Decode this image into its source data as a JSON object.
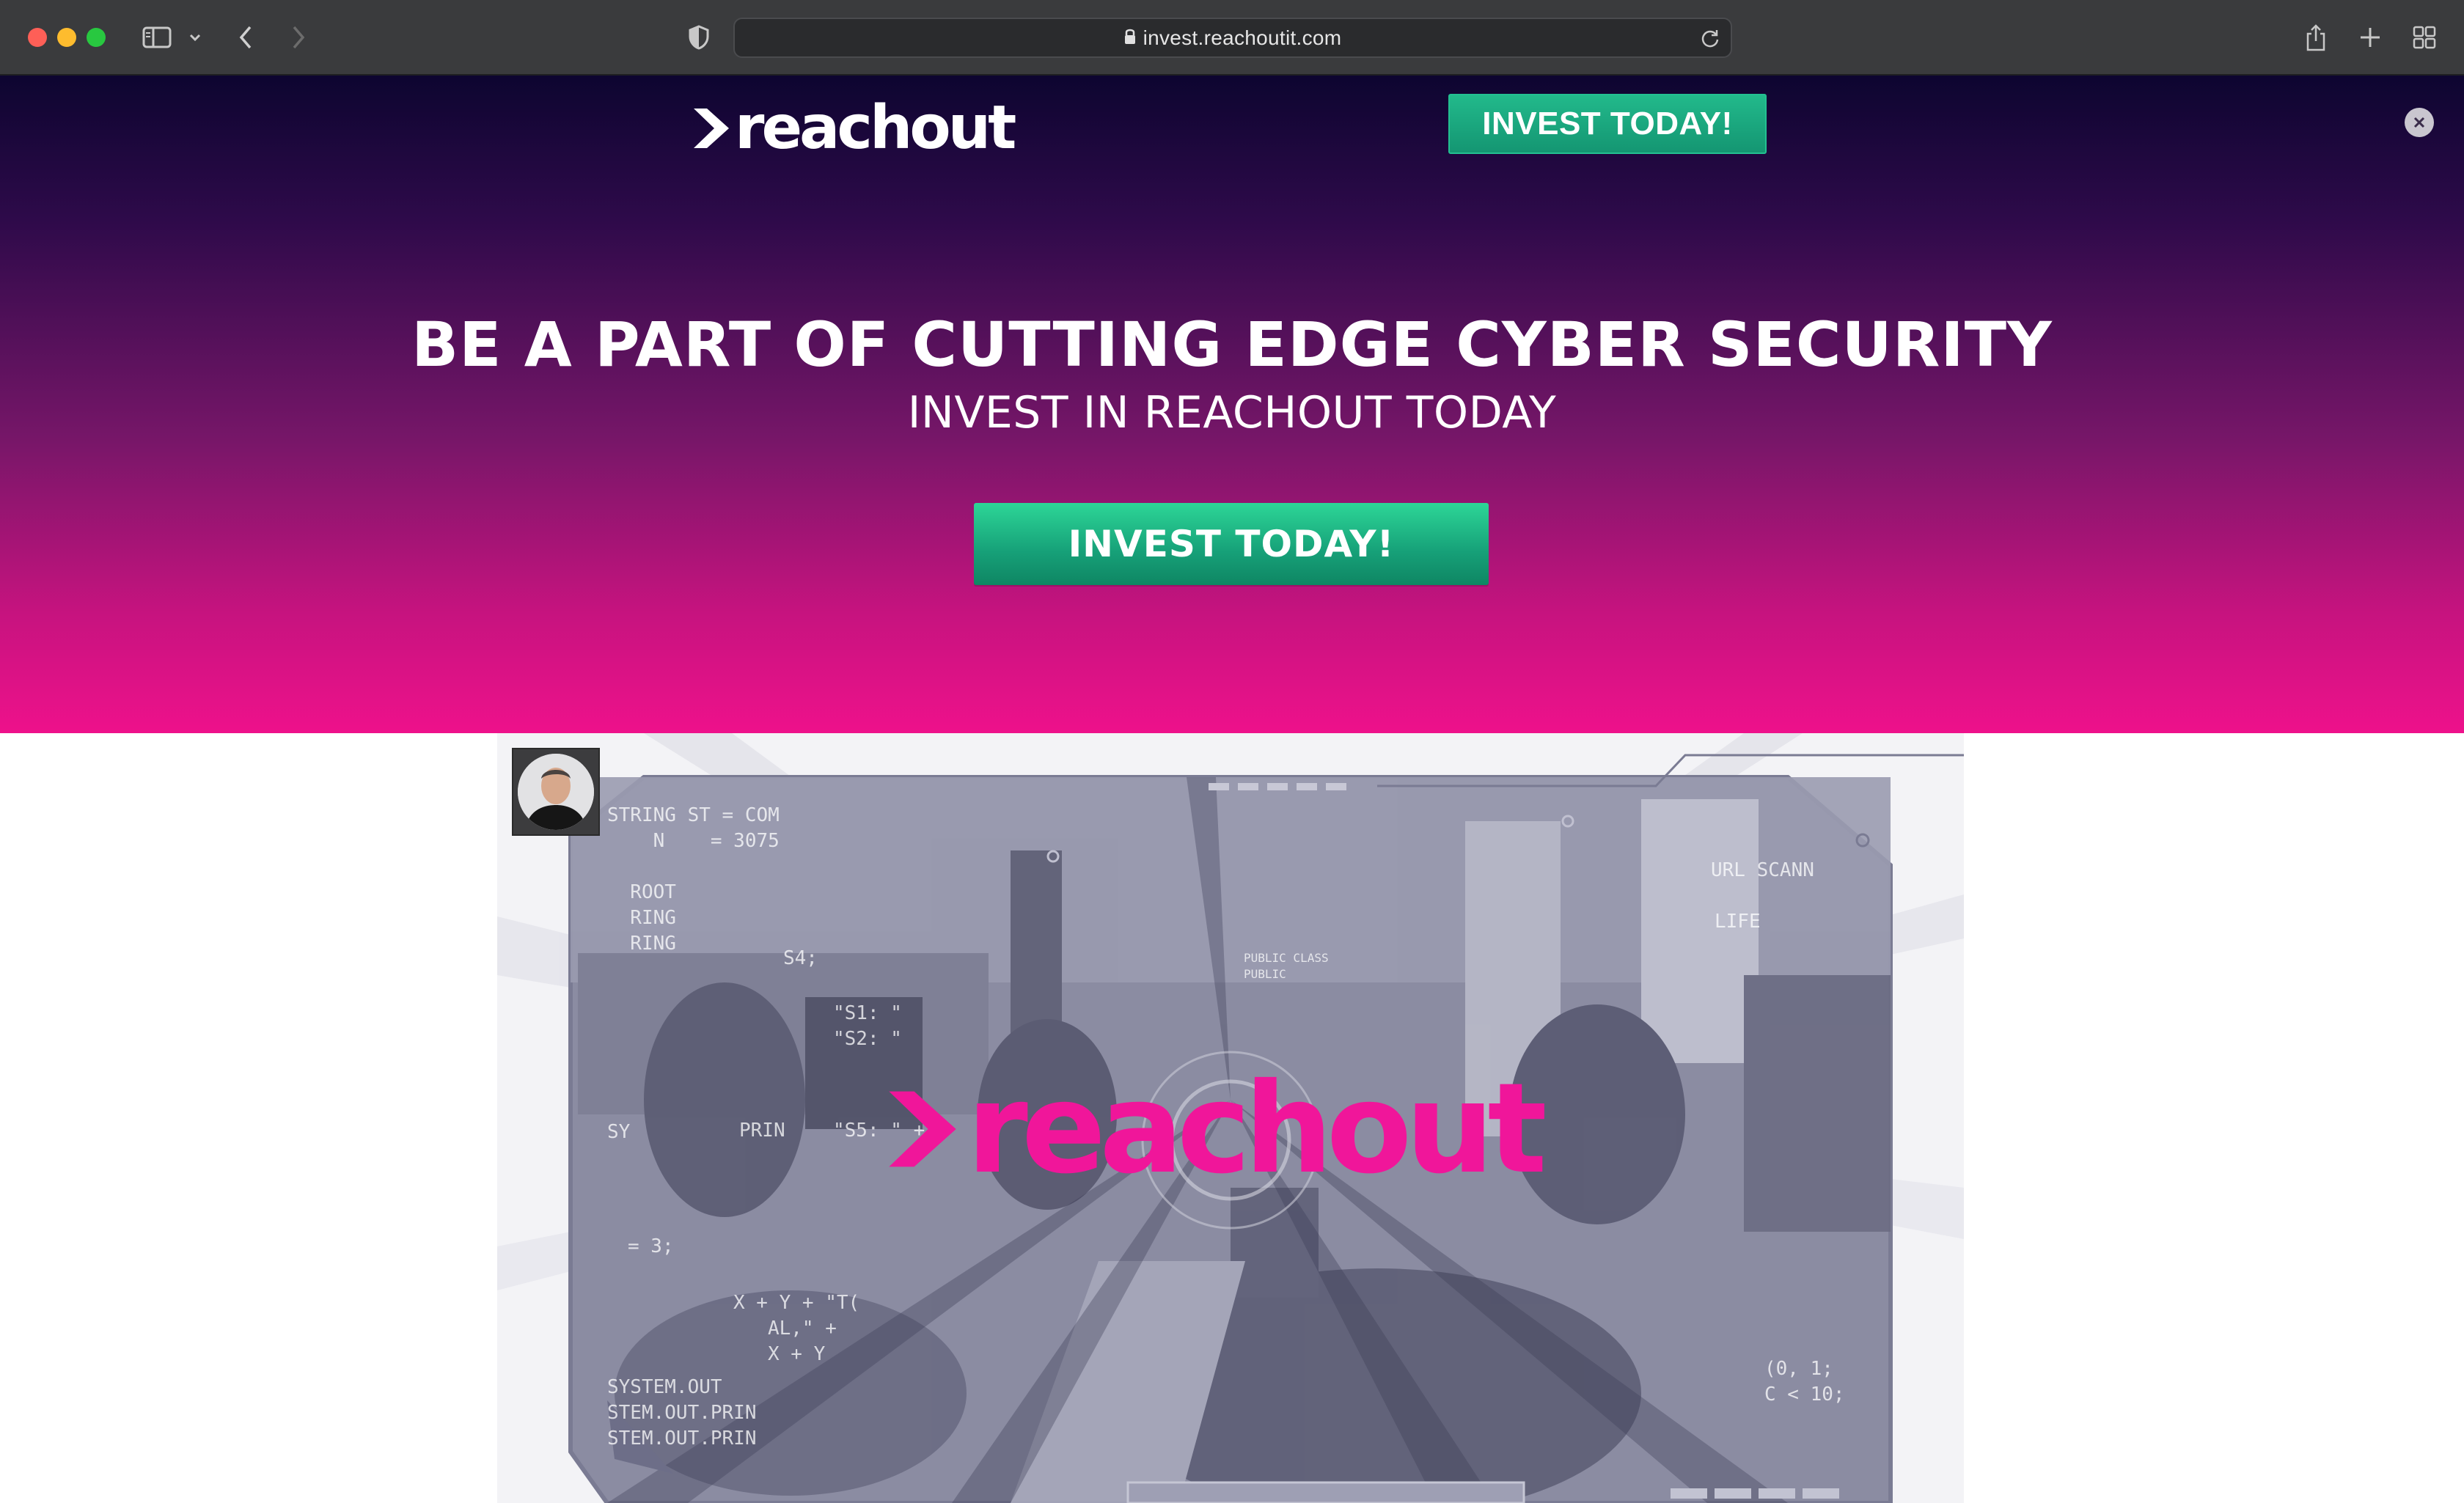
{
  "browser": {
    "url": "invest.reachoutit.com"
  },
  "hero": {
    "logo_text": "reachout",
    "top_button_label": "INVEST TODAY!",
    "title": "BE A PART OF CUTTING EDGE CYBER SECURITY",
    "subtitle": "INVEST IN REACHOUT TODAY",
    "main_button_label": "INVEST TODAY!"
  },
  "video": {
    "logo_text": "reachout",
    "hud_left_top": "STRING ST = COM\n    N    = 3075\n\n  ROOT\n  RING\n  RING",
    "hud_left_mid": "SY",
    "hud_left_low": "= 3;",
    "hud_code_block": "X + Y + \"T(\n   AL,\" +\n   X + Y",
    "hud_bottom_left": "SYSTEM.OUT\nSTEM.OUT.PRIN\nSTEM.OUT.PRIN",
    "hud_s_lines": "\"S1: \"\n\"S2: \"",
    "hud_s4": "S4;",
    "hud_s5": "\"S5: \" +",
    "hud_print": "PRIN",
    "hud_public": "PUBLIC CLASS\nPUBLIC",
    "hud_right_top": "URL SCANN",
    "hud_right_life": "LIFE",
    "hud_right_bottom": "(0, 1;\nC < 10;"
  },
  "colors": {
    "accent_pink": "#ee118b",
    "button_green": "#16a078",
    "hero_top": "#0d0530"
  }
}
